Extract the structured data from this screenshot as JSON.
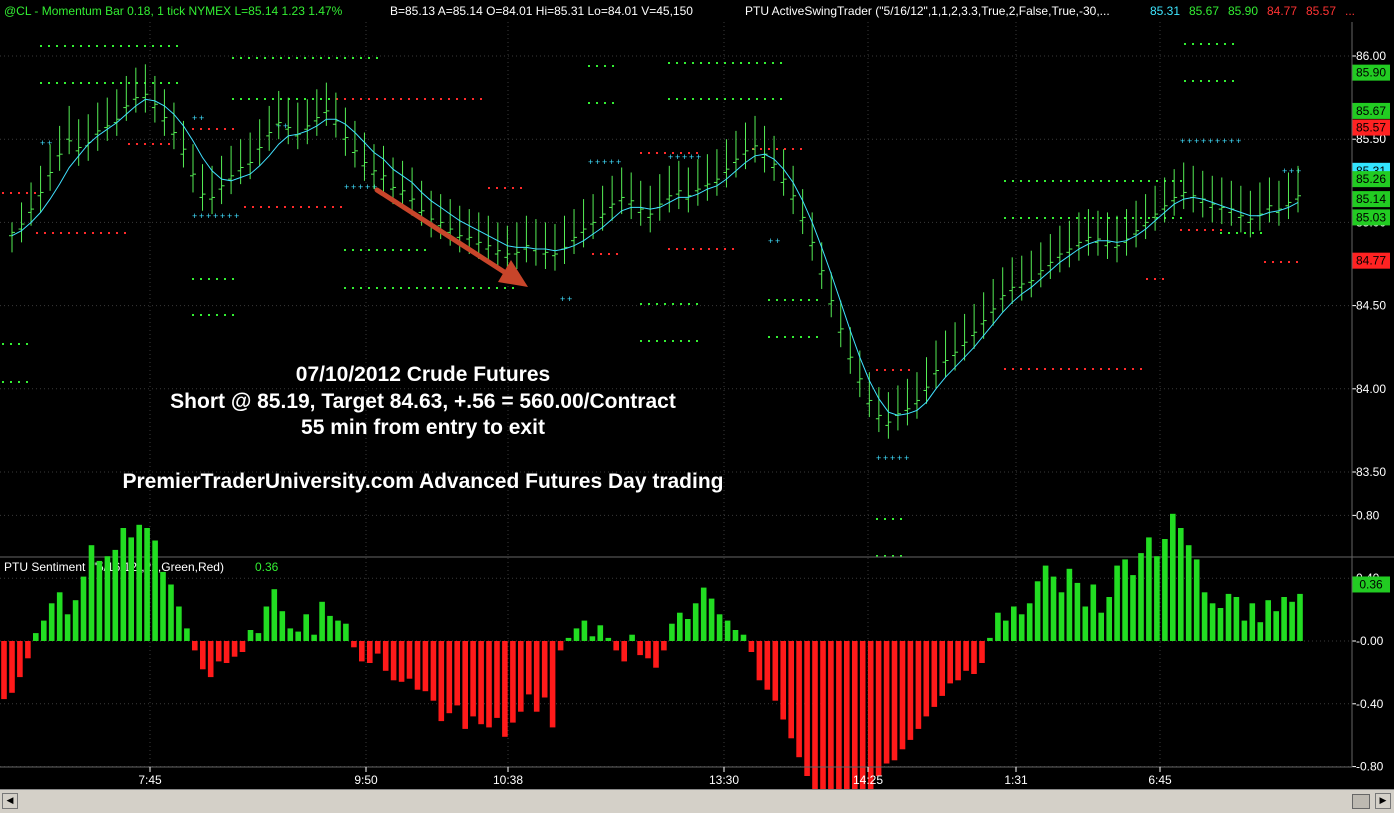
{
  "header": {
    "symbol_line": "@CL - Momentum Bar 0.18, 1 tick  NYMEX  L=85.14  1.23  1.47%",
    "quote_line": "B=85.13  A=85.14  O=84.01  Hi=85.31  Lo=84.01  V=45,150",
    "indicator_name": "PTU  ActiveSwingTrader (\"5/16/12\",1,1,2,3.3,True,2,False,True,-30,...",
    "indicator_values": [
      {
        "text": "85.31",
        "color": "#3ee6ff"
      },
      {
        "text": "85.67",
        "color": "#33ee33"
      },
      {
        "text": "85.90",
        "color": "#33ee33"
      },
      {
        "text": "84.77",
        "color": "#ff3333"
      },
      {
        "text": "85.57",
        "color": "#ff3333"
      },
      {
        "text": "...",
        "color": "#ff3333"
      }
    ]
  },
  "annotation": {
    "line1": "07/10/2012 Crude Futures",
    "line2": "Short @ 85.19, Target 84.63, +.56 = 560.00/Contract",
    "line3": "55 min from entry to exit",
    "line4": "PremierTraderUniversity.com  Advanced Futures Day trading"
  },
  "price_axis": {
    "ticks": [
      "86.00",
      "85.50",
      "85.00",
      "84.50",
      "84.00",
      "83.50"
    ],
    "markers": [
      {
        "text": "85.90",
        "value": 85.9,
        "bg": "#22cc22",
        "fg": "#000000"
      },
      {
        "text": "85.67",
        "value": 85.67,
        "bg": "#22cc22",
        "fg": "#000000"
      },
      {
        "text": "85.57",
        "value": 85.57,
        "bg": "#ff2222",
        "fg": "#000000"
      },
      {
        "text": "85.31",
        "value": 85.31,
        "bg": "#33e5ff",
        "fg": "#000000"
      },
      {
        "text": "85.26",
        "value": 85.26,
        "bg": "#22cc22",
        "fg": "#000000"
      },
      {
        "text": "85.14",
        "value": 85.14,
        "bg": "#22cc22",
        "fg": "#000000"
      },
      {
        "text": "85.03",
        "value": 85.03,
        "bg": "#22cc22",
        "fg": "#000000"
      },
      {
        "text": "84.77",
        "value": 84.77,
        "bg": "#ff2222",
        "fg": "#000000"
      }
    ]
  },
  "sentiment": {
    "label": "PTU  Sentiment (\"5/16/12\",21,Green,Red)",
    "value": "0.36",
    "ticks": [
      "0.80",
      "0.40",
      "-0.00",
      "-0.40",
      "-0.80",
      "-1.20"
    ],
    "marker": {
      "text": "0.36",
      "value": 0.36
    }
  },
  "time_axis": [
    "7:45",
    "9:50",
    "10:38",
    "13:30",
    "14:25",
    "1:31",
    "6:45"
  ],
  "colors": {
    "background": "#000000",
    "bars": "#55ee55",
    "average": "#40e0ff",
    "pos_histogram": "#22dd22",
    "neg_histogram": "#ff1a1a",
    "arrow": "#cc4422",
    "text": "#ffffff"
  },
  "chart_data": [
    {
      "type": "bar",
      "title": "@CL - Momentum Bar 0.18, 1 tick  NYMEX",
      "description_of_marks": "OHLC momentum bars",
      "ylim": [
        83.2,
        86.1
      ],
      "ohlc": [
        [
          84.92,
          85.0,
          84.82,
          84.94
        ],
        [
          84.96,
          85.12,
          84.88,
          84.99
        ],
        [
          85.06,
          85.24,
          84.98,
          85.08
        ],
        [
          85.16,
          85.34,
          85.06,
          85.18
        ],
        [
          85.28,
          85.47,
          85.19,
          85.3
        ],
        [
          85.4,
          85.58,
          85.31,
          85.41
        ],
        [
          85.5,
          85.7,
          85.41,
          85.49
        ],
        [
          85.43,
          85.62,
          85.34,
          85.45
        ],
        [
          85.46,
          85.65,
          85.37,
          85.48
        ],
        [
          85.53,
          85.72,
          85.43,
          85.55
        ],
        [
          85.57,
          85.75,
          85.49,
          85.58
        ],
        [
          85.6,
          85.8,
          85.52,
          85.62
        ],
        [
          85.69,
          85.88,
          85.61,
          85.7
        ],
        [
          85.74,
          85.93,
          85.66,
          85.75
        ],
        [
          85.75,
          85.95,
          85.66,
          85.77
        ],
        [
          85.69,
          85.88,
          85.6,
          85.71
        ],
        [
          85.61,
          85.8,
          85.52,
          85.63
        ],
        [
          85.53,
          85.72,
          85.44,
          85.54
        ],
        [
          85.41,
          85.61,
          85.33,
          85.44
        ],
        [
          85.28,
          85.47,
          85.18,
          85.29
        ],
        [
          85.15,
          85.35,
          85.07,
          85.17
        ],
        [
          85.14,
          85.34,
          85.05,
          85.15
        ],
        [
          85.2,
          85.4,
          85.11,
          85.22
        ],
        [
          85.26,
          85.46,
          85.17,
          85.28
        ],
        [
          85.31,
          85.5,
          85.23,
          85.33
        ],
        [
          85.35,
          85.54,
          85.26,
          85.36
        ],
        [
          85.44,
          85.62,
          85.34,
          85.45
        ],
        [
          85.52,
          85.7,
          85.43,
          85.54
        ],
        [
          85.59,
          85.79,
          85.5,
          85.6
        ],
        [
          85.56,
          85.75,
          85.47,
          85.57
        ],
        [
          85.52,
          85.72,
          85.44,
          85.53
        ],
        [
          85.56,
          85.74,
          85.47,
          85.58
        ],
        [
          85.61,
          85.8,
          85.52,
          85.63
        ],
        [
          85.66,
          85.84,
          85.58,
          85.67
        ],
        [
          85.59,
          85.78,
          85.51,
          85.61
        ],
        [
          85.5,
          85.69,
          85.4,
          85.51
        ],
        [
          85.42,
          85.61,
          85.33,
          85.43
        ],
        [
          85.34,
          85.54,
          85.25,
          85.36
        ],
        [
          85.29,
          85.47,
          85.2,
          85.31
        ],
        [
          85.26,
          85.46,
          85.17,
          85.28
        ],
        [
          85.2,
          85.39,
          85.11,
          85.21
        ],
        [
          85.17,
          85.37,
          85.08,
          85.19
        ],
        [
          85.13,
          85.33,
          85.04,
          85.14
        ],
        [
          85.06,
          85.25,
          84.98,
          85.07
        ],
        [
          85.0,
          85.19,
          84.91,
          85.02
        ],
        [
          84.98,
          85.17,
          84.9,
          85.0
        ],
        [
          84.94,
          85.14,
          84.86,
          84.96
        ],
        [
          84.91,
          85.1,
          84.82,
          84.92
        ],
        [
          84.9,
          85.08,
          84.81,
          84.91
        ],
        [
          84.87,
          85.06,
          84.78,
          84.88
        ],
        [
          84.84,
          85.04,
          84.76,
          84.86
        ],
        [
          84.81,
          85.0,
          84.73,
          84.83
        ],
        [
          84.79,
          84.98,
          84.71,
          84.81
        ],
        [
          84.81,
          85.0,
          84.72,
          84.82
        ],
        [
          84.84,
          85.04,
          84.76,
          84.86
        ],
        [
          84.83,
          85.02,
          84.74,
          84.84
        ],
        [
          84.81,
          85.0,
          84.72,
          84.82
        ],
        [
          84.8,
          84.99,
          84.71,
          84.81
        ],
        [
          84.84,
          85.04,
          84.75,
          84.85
        ],
        [
          84.89,
          85.08,
          84.81,
          84.91
        ],
        [
          84.94,
          85.14,
          84.85,
          84.96
        ],
        [
          84.99,
          85.17,
          84.9,
          85.0
        ],
        [
          85.03,
          85.22,
          84.95,
          85.05
        ],
        [
          85.09,
          85.28,
          85.01,
          85.11
        ],
        [
          85.13,
          85.33,
          85.05,
          85.15
        ],
        [
          85.11,
          85.3,
          85.02,
          85.13
        ],
        [
          85.06,
          85.25,
          84.98,
          85.08
        ],
        [
          85.03,
          85.22,
          84.94,
          85.05
        ],
        [
          85.09,
          85.29,
          85.01,
          85.11
        ],
        [
          85.14,
          85.34,
          85.06,
          85.16
        ],
        [
          85.17,
          85.37,
          85.08,
          85.19
        ],
        [
          85.14,
          85.33,
          85.06,
          85.16
        ],
        [
          85.19,
          85.38,
          85.1,
          85.2
        ],
        [
          85.22,
          85.41,
          85.13,
          85.23
        ],
        [
          85.24,
          85.44,
          85.16,
          85.26
        ],
        [
          85.3,
          85.5,
          85.21,
          85.32
        ],
        [
          85.36,
          85.55,
          85.27,
          85.38
        ],
        [
          85.41,
          85.6,
          85.32,
          85.43
        ],
        [
          85.44,
          85.64,
          85.36,
          85.46
        ],
        [
          85.39,
          85.58,
          85.3,
          85.41
        ],
        [
          85.33,
          85.52,
          85.25,
          85.35
        ],
        [
          85.24,
          85.44,
          85.16,
          85.26
        ],
        [
          85.14,
          85.34,
          85.05,
          85.16
        ],
        [
          85.01,
          85.2,
          84.93,
          85.03
        ],
        [
          84.86,
          85.06,
          84.77,
          84.88
        ],
        [
          84.69,
          84.88,
          84.6,
          84.71
        ],
        [
          84.51,
          84.7,
          84.43,
          84.53
        ],
        [
          84.34,
          84.53,
          84.25,
          84.36
        ],
        [
          84.18,
          84.37,
          84.09,
          84.19
        ],
        [
          84.04,
          84.23,
          83.95,
          84.06
        ],
        [
          83.91,
          84.1,
          83.83,
          83.93
        ],
        [
          83.82,
          84.01,
          83.74,
          83.84
        ],
        [
          83.78,
          83.98,
          83.7,
          83.8
        ],
        [
          83.84,
          84.02,
          83.75,
          83.85
        ],
        [
          83.87,
          84.06,
          83.78,
          83.88
        ],
        [
          83.91,
          84.1,
          83.82,
          83.93
        ],
        [
          83.99,
          84.19,
          83.91,
          84.01
        ],
        [
          84.09,
          84.29,
          84.0,
          84.11
        ],
        [
          84.16,
          84.35,
          84.07,
          84.17
        ],
        [
          84.2,
          84.4,
          84.11,
          84.22
        ],
        [
          84.26,
          84.45,
          84.17,
          84.28
        ],
        [
          84.32,
          84.51,
          84.24,
          84.34
        ],
        [
          84.39,
          84.58,
          84.3,
          84.41
        ],
        [
          84.46,
          84.66,
          84.38,
          84.48
        ],
        [
          84.54,
          84.73,
          84.46,
          84.56
        ],
        [
          84.59,
          84.79,
          84.51,
          84.61
        ],
        [
          84.61,
          84.8,
          84.53,
          84.63
        ],
        [
          84.64,
          84.83,
          84.55,
          84.65
        ],
        [
          84.69,
          84.88,
          84.61,
          84.71
        ],
        [
          84.74,
          84.93,
          84.66,
          84.76
        ],
        [
          84.79,
          84.98,
          84.7,
          84.81
        ],
        [
          84.82,
          85.01,
          84.73,
          84.84
        ],
        [
          84.86,
          85.06,
          84.77,
          84.88
        ],
        [
          84.89,
          85.08,
          84.8,
          84.91
        ],
        [
          84.88,
          85.07,
          84.8,
          84.9
        ],
        [
          84.86,
          85.06,
          84.78,
          84.88
        ],
        [
          84.85,
          85.04,
          84.76,
          84.86
        ],
        [
          84.88,
          85.08,
          84.8,
          84.9
        ],
        [
          84.93,
          85.13,
          84.85,
          84.95
        ],
        [
          84.98,
          85.17,
          84.9,
          85.0
        ],
        [
          85.03,
          85.22,
          84.95,
          85.05
        ],
        [
          85.08,
          85.27,
          85.0,
          85.1
        ],
        [
          85.13,
          85.32,
          85.04,
          85.15
        ],
        [
          85.16,
          85.36,
          85.08,
          85.18
        ],
        [
          85.15,
          85.34,
          85.06,
          85.16
        ],
        [
          85.12,
          85.31,
          85.03,
          85.14
        ],
        [
          85.09,
          85.28,
          85.0,
          85.11
        ],
        [
          85.08,
          85.27,
          84.99,
          85.09
        ],
        [
          85.06,
          85.25,
          84.98,
          85.08
        ],
        [
          85.03,
          85.22,
          84.94,
          85.04
        ],
        [
          85.0,
          85.19,
          84.91,
          85.02
        ],
        [
          85.04,
          85.24,
          84.95,
          85.05
        ],
        [
          85.08,
          85.27,
          85.0,
          85.1
        ],
        [
          85.06,
          85.25,
          84.98,
          85.08
        ],
        [
          85.1,
          85.3,
          85.02,
          85.12
        ],
        [
          85.14,
          85.34,
          85.06,
          85.16
        ]
      ],
      "average_line": [
        84.92,
        84.95,
        85.0,
        85.06,
        85.14,
        85.23,
        85.33,
        85.4,
        85.47,
        85.52,
        85.56,
        85.6,
        85.65,
        85.7,
        85.74,
        85.73,
        85.7,
        85.65,
        85.58,
        85.49,
        85.39,
        85.31,
        85.26,
        85.25,
        85.27,
        85.29,
        85.34,
        85.4,
        85.47,
        85.52,
        85.53,
        85.55,
        85.58,
        85.62,
        85.62,
        85.59,
        85.54,
        85.48,
        85.42,
        85.38,
        85.32,
        85.28,
        85.24,
        85.18,
        85.13,
        85.09,
        85.05,
        85.01,
        84.98,
        84.95,
        84.92,
        84.89,
        84.86,
        84.85,
        84.85,
        84.84,
        84.84,
        84.83,
        84.84,
        84.86,
        84.89,
        84.93,
        84.97,
        85.02,
        85.07,
        85.09,
        85.09,
        85.08,
        85.09,
        85.12,
        85.15,
        85.15,
        85.17,
        85.2,
        85.22,
        85.26,
        85.31,
        85.36,
        85.4,
        85.41,
        85.38,
        85.32,
        85.24,
        85.13,
        85.0,
        84.85,
        84.69,
        84.52,
        84.35,
        84.19,
        84.05,
        83.94,
        83.86,
        83.84,
        83.85,
        83.87,
        83.92,
        84.0,
        84.07,
        84.13,
        84.19,
        84.25,
        84.32,
        84.39,
        84.46,
        84.52,
        84.57,
        84.61,
        84.66,
        84.71,
        84.76,
        84.8,
        84.84,
        84.87,
        84.89,
        84.89,
        84.88,
        84.89,
        84.92,
        84.96,
        85.01,
        85.06,
        85.11,
        85.14,
        85.15,
        85.14,
        85.12,
        85.1,
        85.08,
        85.06,
        85.04,
        85.04,
        85.06,
        85.07,
        85.09,
        85.12
      ]
    },
    {
      "type": "bar",
      "title": "PTU  Sentiment (\"5/16/12\",21,Green,Red)",
      "ylim": [
        -1.32,
        0.92
      ],
      "values": [
        -0.37,
        -0.33,
        -0.23,
        -0.11,
        0.05,
        0.13,
        0.24,
        0.31,
        0.17,
        0.26,
        0.41,
        0.61,
        0.51,
        0.54,
        0.58,
        0.72,
        0.66,
        0.74,
        0.72,
        0.64,
        0.44,
        0.36,
        0.22,
        0.08,
        -0.06,
        -0.18,
        -0.23,
        -0.13,
        -0.14,
        -0.1,
        -0.07,
        0.07,
        0.05,
        0.22,
        0.33,
        0.19,
        0.08,
        0.06,
        0.17,
        0.04,
        0.25,
        0.16,
        0.13,
        0.11,
        -0.04,
        -0.13,
        -0.14,
        -0.08,
        -0.19,
        -0.25,
        -0.26,
        -0.24,
        -0.31,
        -0.32,
        -0.38,
        -0.51,
        -0.46,
        -0.41,
        -0.56,
        -0.48,
        -0.53,
        -0.55,
        -0.49,
        -0.61,
        -0.52,
        -0.45,
        -0.34,
        -0.45,
        -0.36,
        -0.55,
        -0.06,
        0.02,
        0.08,
        0.13,
        0.03,
        0.1,
        0.02,
        -0.06,
        -0.13,
        0.04,
        -0.09,
        -0.11,
        -0.17,
        -0.06,
        0.11,
        0.18,
        0.14,
        0.24,
        0.34,
        0.27,
        0.17,
        0.13,
        0.07,
        0.04,
        -0.07,
        -0.25,
        -0.31,
        -0.38,
        -0.5,
        -0.62,
        -0.74,
        -0.86,
        -0.96,
        -1.1,
        -1.19,
        -1.26,
        -1.16,
        -1.11,
        -1.04,
        -0.96,
        -0.86,
        -0.78,
        -0.76,
        -0.69,
        -0.63,
        -0.56,
        -0.48,
        -0.42,
        -0.35,
        -0.27,
        -0.25,
        -0.19,
        -0.21,
        -0.14,
        0.02,
        0.18,
        0.13,
        0.22,
        0.17,
        0.24,
        0.38,
        0.48,
        0.41,
        0.31,
        0.46,
        0.37,
        0.22,
        0.36,
        0.18,
        0.28,
        0.48,
        0.52,
        0.42,
        0.56,
        0.66,
        0.54,
        0.65,
        0.81,
        0.72,
        0.61,
        0.52,
        0.31,
        0.24,
        0.21,
        0.3,
        0.28,
        0.13,
        0.24,
        0.12,
        0.26,
        0.19,
        0.28,
        0.25,
        0.3
      ],
      "colors": {
        "positive": "#22dd22",
        "negative": "#ff1a1a"
      }
    }
  ]
}
